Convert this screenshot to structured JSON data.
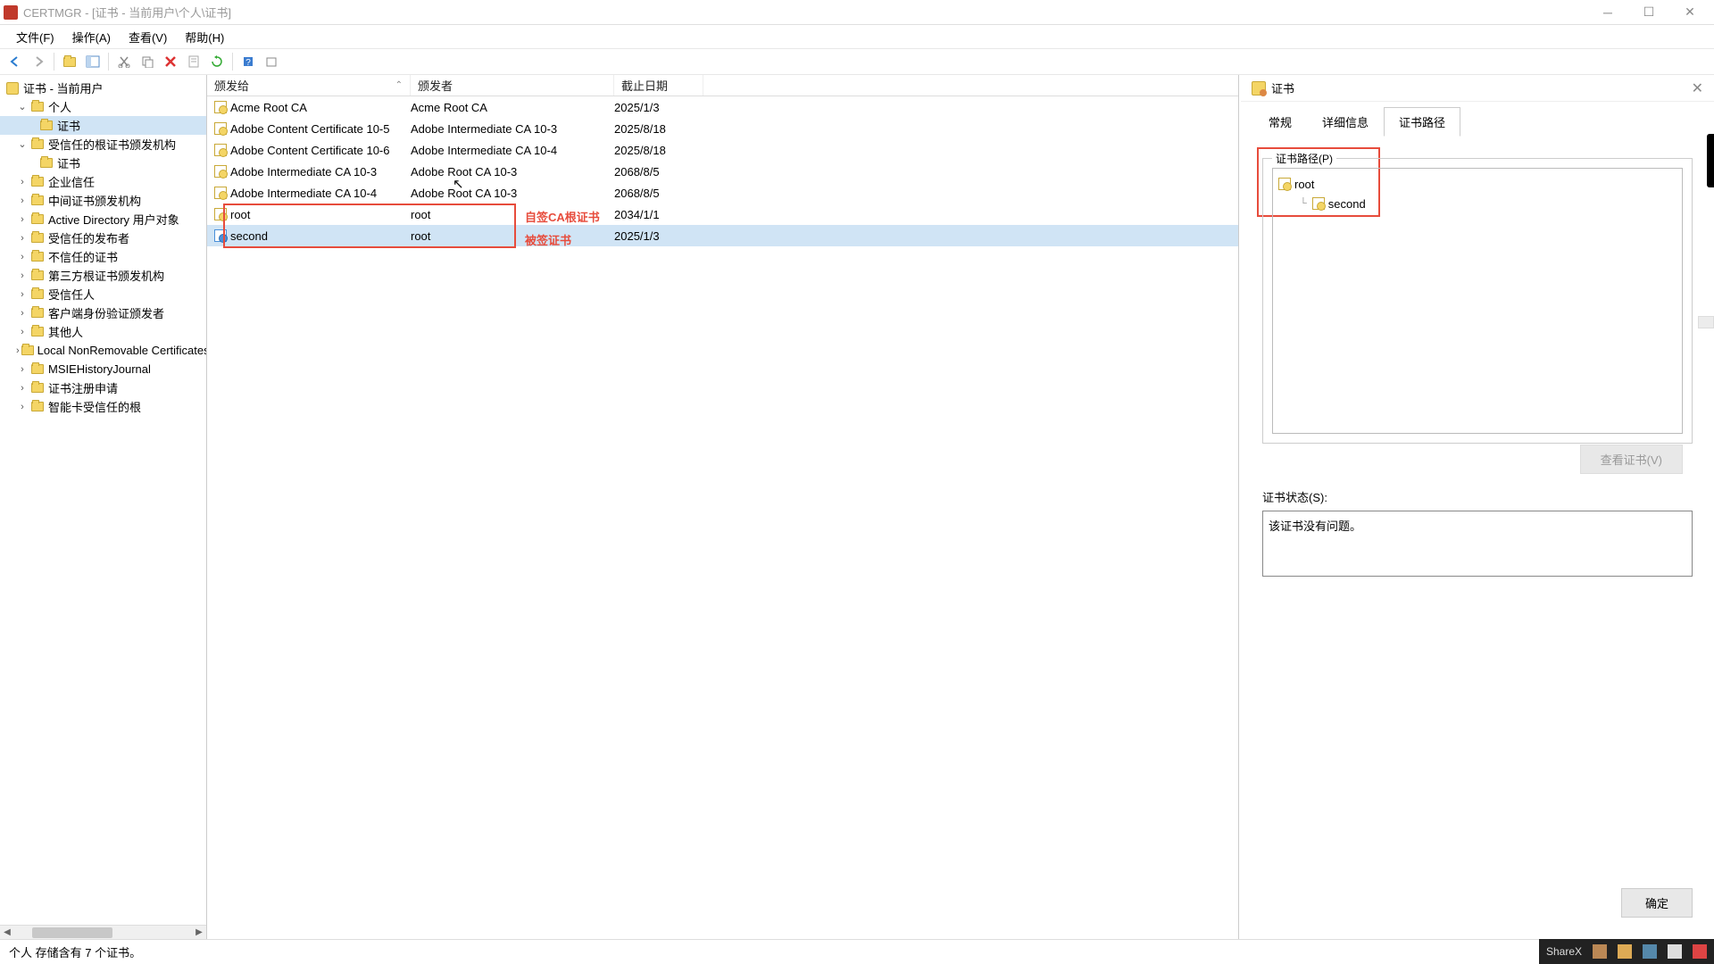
{
  "window": {
    "title": "CERTMGR - [证书 - 当前用户\\个人\\证书]",
    "menu": [
      "文件(F)",
      "操作(A)",
      "查看(V)",
      "帮助(H)"
    ]
  },
  "tree": {
    "root": "证书 - 当前用户",
    "nodes": [
      {
        "label": "个人",
        "expanded": true,
        "children": [
          {
            "label": "证书",
            "selected": true
          }
        ]
      },
      {
        "label": "受信任的根证书颁发机构",
        "expanded": true,
        "children": [
          {
            "label": "证书"
          }
        ]
      },
      {
        "label": "企业信任"
      },
      {
        "label": "中间证书颁发机构"
      },
      {
        "label": "Active Directory 用户对象"
      },
      {
        "label": "受信任的发布者"
      },
      {
        "label": "不信任的证书"
      },
      {
        "label": "第三方根证书颁发机构"
      },
      {
        "label": "受信任人"
      },
      {
        "label": "客户端身份验证颁发者"
      },
      {
        "label": "其他人"
      },
      {
        "label": "Local NonRemovable Certificates"
      },
      {
        "label": "MSIEHistoryJournal"
      },
      {
        "label": "证书注册申请"
      },
      {
        "label": "智能卡受信任的根"
      }
    ]
  },
  "list": {
    "headers": {
      "issued_to": "颁发给",
      "issued_by": "颁发者",
      "expiry": "截止日期"
    },
    "rows": [
      {
        "issued_to": "Acme Root CA",
        "issued_by": "Acme Root CA",
        "expiry": "2025/1/3"
      },
      {
        "issued_to": "Adobe Content Certificate 10-5",
        "issued_by": "Adobe Intermediate CA 10-3",
        "expiry": "2025/8/18"
      },
      {
        "issued_to": "Adobe Content Certificate 10-6",
        "issued_by": "Adobe Intermediate CA 10-4",
        "expiry": "2025/8/18"
      },
      {
        "issued_to": "Adobe Intermediate CA 10-3",
        "issued_by": "Adobe Root CA 10-3",
        "expiry": "2068/8/5"
      },
      {
        "issued_to": "Adobe Intermediate CA 10-4",
        "issued_by": "Adobe Root CA 10-3",
        "expiry": "2068/8/5"
      },
      {
        "issued_to": "root",
        "issued_by": "root",
        "expiry": "2034/1/1"
      },
      {
        "issued_to": "second",
        "issued_by": "root",
        "expiry": "2025/1/3",
        "selected": true
      }
    ],
    "annotations": {
      "root_label": "自签CA根证书",
      "second_label": "被签证书"
    }
  },
  "dialog": {
    "title": "证书",
    "tabs": [
      "常规",
      "详细信息",
      "证书路径"
    ],
    "active_tab": 2,
    "path_legend": "证书路径(P)",
    "path": [
      {
        "label": "root",
        "level": 0
      },
      {
        "label": "second",
        "level": 1
      }
    ],
    "view_cert": "查看证书(V)",
    "status_label": "证书状态(S):",
    "status_text": "该证书没有问题。",
    "ok": "确定"
  },
  "statusbar": "个人 存储含有 7 个证书。",
  "tray": {
    "label": "ShareX"
  }
}
